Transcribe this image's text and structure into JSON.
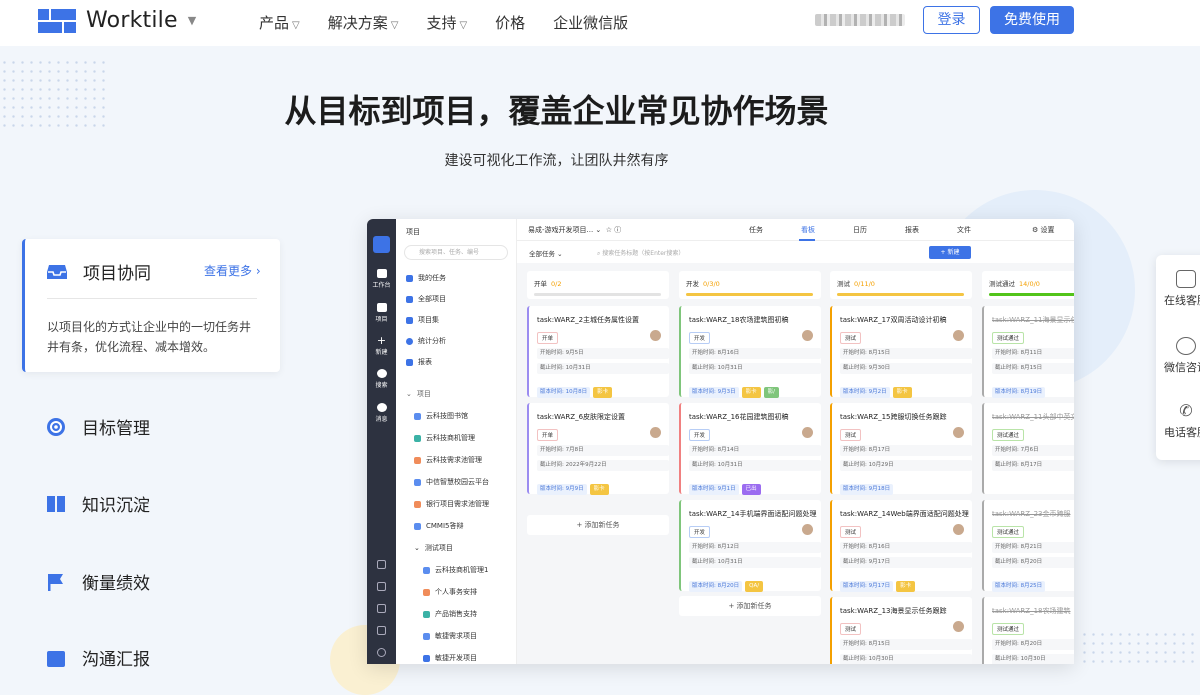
{
  "header": {
    "brand": "Worktile",
    "brand_caret": "⌄",
    "nav": [
      {
        "label": "产品",
        "caret": true
      },
      {
        "label": "解决方案",
        "caret": true
      },
      {
        "label": "支持",
        "caret": true
      },
      {
        "label": "价格",
        "caret": false
      },
      {
        "label": "企业微信版",
        "caret": false
      }
    ],
    "login_label": "登录",
    "free_label": "免费使用"
  },
  "hero": {
    "title": "从目标到项目，覆盖企业常见协作场景",
    "subtitle": "建设可视化工作流，让团队井然有序"
  },
  "features": {
    "active": {
      "title": "项目协同",
      "more": "查看更多 ›",
      "desc": "以项目化的方式让企业中的一切任务井井有条，优化流程、减本增效。"
    },
    "items": [
      "目标管理",
      "知识沉淀",
      "衡量绩效",
      "沟通汇报"
    ]
  },
  "app": {
    "rail": [
      "工作台",
      "项目",
      "新建",
      "搜索",
      "消息"
    ],
    "sidebar": {
      "title": "项目",
      "search_placeholder": "搜索项目、任务、编号",
      "quick": [
        "我的任务",
        "全部项目",
        "项目集",
        "统计分析",
        "报表"
      ],
      "group_label": "项目",
      "projects": [
        "云科技图书馆",
        "云科技商机管理",
        "云科技需求池管理",
        "中信智慧校园云平台",
        "银行项目需求池管理",
        "CMMI5答辩",
        "测试项目"
      ],
      "sub_projects": [
        "云科技商机管理1",
        "个人事务安排",
        "产品销售支持",
        "敏捷需求项目",
        "敏捷开发项目"
      ]
    },
    "project_name": "易成-游戏开发项目...",
    "tabs": [
      "任务",
      "看板",
      "日历",
      "报表",
      "文件"
    ],
    "active_tab": "看板",
    "settings_label": "设置",
    "toolbar": {
      "filter": "全部任务",
      "search_placeholder": "搜索任务标题（按Enter搜索）",
      "new_label": "+ 新建"
    },
    "add_task_label": "添加新任务",
    "columns": [
      {
        "name": "开单",
        "count": "0/2",
        "bar_color": "#e3e3e3",
        "cards": [
          {
            "title": "task:WARZ_2主城任务属性设置",
            "status": "开单",
            "start": "开始时间: 9月5日",
            "end": "截止时间: 10月31日",
            "version": "版本时间: 10月8日",
            "chip": "影卡"
          },
          {
            "title": "task:WARZ_6皮肤限定设置",
            "status": "开单",
            "start": "开始时间: 7月8日",
            "end": "截止时间: 2022年9月22日",
            "version": "版本时间: 9月9日",
            "chip": "影卡"
          }
        ]
      },
      {
        "name": "开发",
        "count": "0/3/0",
        "bar_color": "#f4c542",
        "cards": [
          {
            "title": "task:WARZ_18农场建筑图初稿",
            "status": "开发",
            "start": "开始时间: 8月16日",
            "end": "截止时间: 10月31日",
            "version": "版本时间: 9月3日",
            "chip": "影卡",
            "chip2": "影/"
          },
          {
            "title": "task:WARZ_16花园建筑图初稿",
            "status": "开发",
            "start": "开始时间: 8月14日",
            "end": "截止时间: 10月31日",
            "version": "版本时间: 9月1日",
            "chip": "已出"
          },
          {
            "title": "task:WARZ_14手机端界面适配问题处理",
            "status": "开发",
            "start": "开始时间: 8月12日",
            "end": "截止时间: 10月31日",
            "version": "版本时间: 8月20日",
            "chip": "QA/"
          }
        ]
      },
      {
        "name": "测试",
        "count": "0/11/0",
        "bar_color": "#f4c542",
        "cards": [
          {
            "title": "task:WARZ_17双周活动设计初稿",
            "status": "测试",
            "start": "开始时间: 8月15日",
            "end": "截止时间: 9月30日",
            "version": "版本时间: 9月2日",
            "chip": "影卡"
          },
          {
            "title": "task:WARZ_15跨服切换任务跟踪",
            "status": "测试",
            "start": "开始时间: 8月17日",
            "end": "截止时间: 10月29日",
            "version": "版本时间: 9月18日",
            "chip": ""
          },
          {
            "title": "task:WARZ_14Web端界面适配问题处理",
            "status": "测试",
            "start": "开始时间: 8月16日",
            "end": "截止时间: 9月17日",
            "version": "版本时间: 9月17日",
            "chip": "影卡"
          },
          {
            "title": "task:WARZ_13海景显示任务跟踪",
            "status": "测试",
            "start": "开始时间: 8月15日",
            "end": "截止时间: 10月30日",
            "version": "",
            "chip": ""
          }
        ]
      },
      {
        "name": "测试通过",
        "count": "14/0/0",
        "bar_color": "#52c41a",
        "cards": [
          {
            "title": "task:WARZ_11海景显示任",
            "status": "测试通过",
            "start": "开始时间: 8月11日",
            "end": "截止时间: 8月15日",
            "version": "版本时间: 8月19日"
          },
          {
            "title": "task:WARZ_11头部中英文",
            "status": "测试通过",
            "start": "开始时间: 7月6日",
            "end": "截止时间: 8月17日",
            "version": ""
          },
          {
            "title": "task:WARZ_23金币跨服",
            "status": "测试通过",
            "start": "开始时间: 8月21日",
            "end": "截止时间: 8月20日",
            "version": "版本时间: 8月25日"
          },
          {
            "title": "task:WARZ_18农场建筑",
            "status": "测试通过",
            "start": "开始时间: 8月20日",
            "end": "截止时间: 10月30日",
            "version": ""
          }
        ]
      }
    ]
  },
  "float_bar": [
    "在线客服",
    "微信咨询",
    "电话客服"
  ]
}
